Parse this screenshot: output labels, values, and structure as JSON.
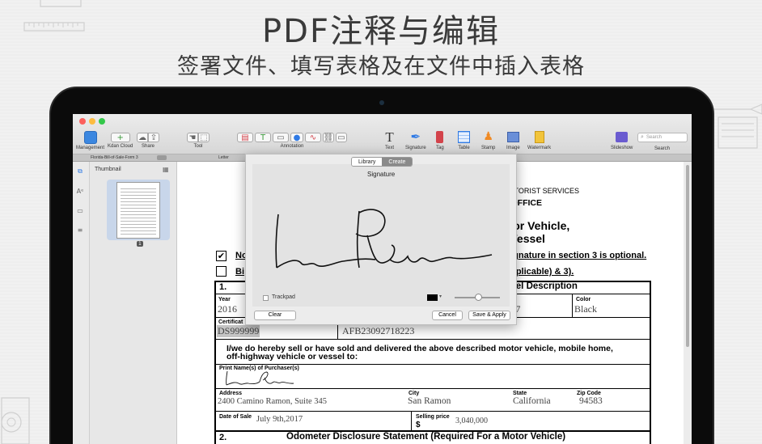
{
  "headline": "PDF注释与编辑",
  "subhead": "签署文件、填写表格及在文件中插入表格",
  "colors": {
    "accent": "#2f7ae5",
    "close": "#fc605c",
    "minimize": "#fdbc40",
    "zoom": "#34c84a"
  },
  "toolbar": {
    "management": "Management",
    "kdan_cloud": "Kdan Cloud",
    "share": "Share",
    "tool": "Tool",
    "annotation": "Annotation",
    "text": "Text",
    "signature": "Signature",
    "tag": "Tag",
    "table": "Table",
    "stamp": "Stamp",
    "image": "Image",
    "watermark": "Watermark",
    "slideshow": "Slideshow",
    "search_label": "Search",
    "search_placeholder": "Search"
  },
  "tabs": {
    "file": "Florida-Bill-of-Sale-Form 3",
    "letter": "Letter"
  },
  "sidebar": {
    "thumbnail_label": "Thumbnail",
    "page_number": "1"
  },
  "dialog": {
    "tab_library": "Library",
    "tab_create": "Create",
    "title": "Signature",
    "trackpad_label": "Trackpad",
    "clear_button": "Clear",
    "cancel_button": "Cancel",
    "save_button": "Save & Apply",
    "ink_color": "#000000"
  },
  "form": {
    "header1": "MOTORIST SERVICES",
    "header2": "R OFFICE",
    "title1": "otor Vehicle,",
    "title2": "r Vessel",
    "line_no_prefix": "No",
    "line_no_rest": "signature in section 3 is optional.",
    "line_bi_prefix": "Bi",
    "line_bi_rest": "applicable) & 3).",
    "section1_num": "1.",
    "section1_title": "ssel Description",
    "year_label": "Year",
    "year_value": "2016",
    "model_partial": "e C7",
    "color_label": "Color",
    "color_value": "Black",
    "cert_label": "Certificat",
    "cert_value": "DS999999",
    "vin_value": "AFB23092718223",
    "statement_line1": "I/we do hereby sell or have sold and delivered the above described motor vehicle, mobile home,",
    "statement_line2": "off-highway vehicle or vessel to:",
    "print_name_label": "Print Name(s) of Purchaser(s)",
    "address_label": "Address",
    "address_value": "2400 Camino Ramon, Suite 345",
    "city_label": "City",
    "city_value": "San Ramon",
    "state_label": "State",
    "state_value": "California",
    "zip_label": "Zip Code",
    "zip_value": "94583",
    "date_label": "Date of Sale",
    "date_value": "July 9th,2017",
    "price_label": "Selling price",
    "price_currency": "$",
    "price_value": "3,040,000",
    "section2_num": "2.",
    "section2_title": "Odometer Disclosure Statement (Required For a Motor Vehicle)"
  }
}
